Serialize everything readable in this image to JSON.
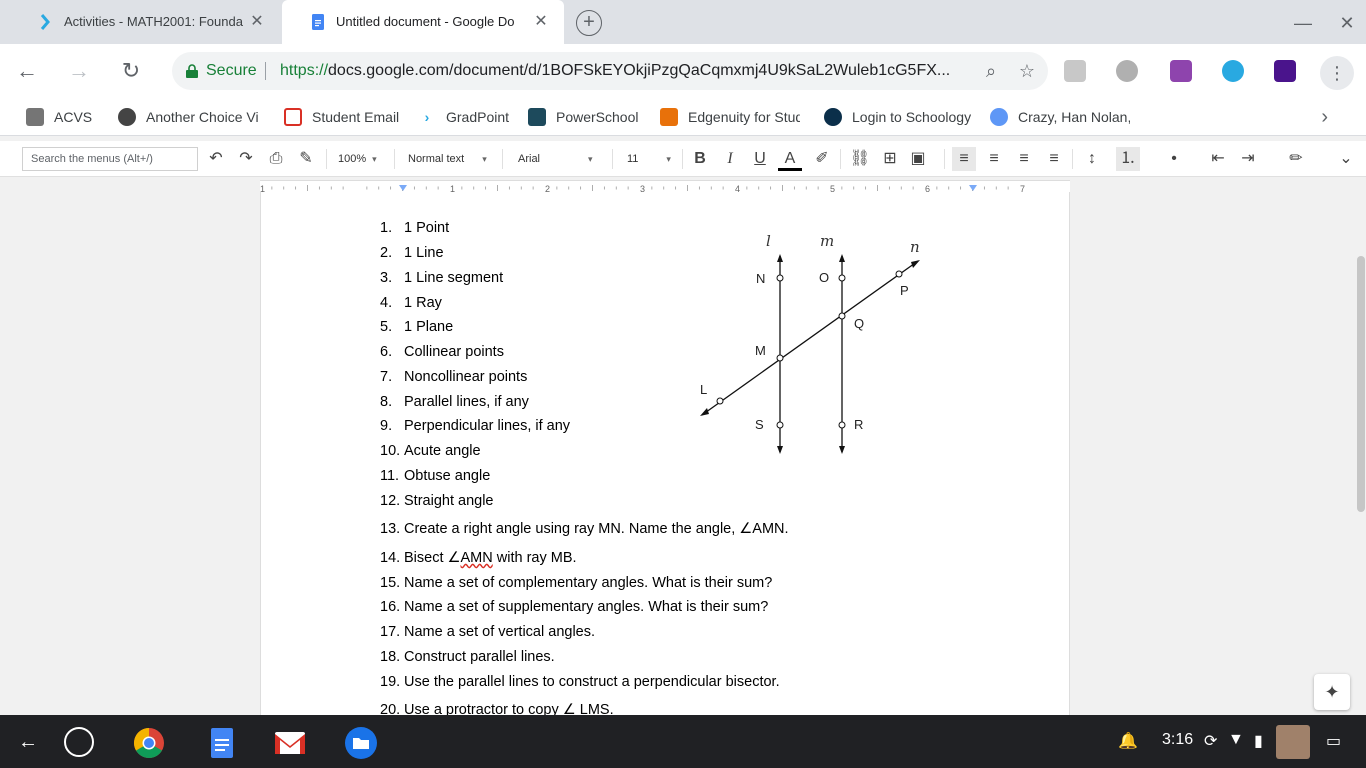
{
  "browser": {
    "tabs": [
      {
        "title": "Activities - MATH2001: Founda",
        "active": false
      },
      {
        "title": "Untitled document - Google Do",
        "active": true
      }
    ],
    "omnibox": {
      "secure_label": "Secure",
      "url_scheme": "https://",
      "url_rest": "docs.google.com/document/d/1BOFSkEYOkjiPzgQaCqmxmj4U9kSaL2Wuleb1cG5FX..."
    },
    "bookmarks": [
      "ACVS",
      "Another Choice Vir",
      "Student Email",
      "GradPoint",
      "PowerSchool",
      "Edgenuity for Stud",
      "Login to Schoology",
      "Crazy, Han Nolan, I"
    ]
  },
  "toolbar": {
    "search_placeholder": "Search the menus (Alt+/)",
    "zoom": "100%",
    "style": "Normal text",
    "font": "Arial",
    "size": "11",
    "bold": "B",
    "italic": "I",
    "underline": "U",
    "text_color": "A"
  },
  "ruler": {
    "marks": [
      "1",
      "1",
      "2",
      "3",
      "4",
      "5",
      "6",
      "7"
    ]
  },
  "document": {
    "items": [
      {
        "num": "1.",
        "text": "1 Point"
      },
      {
        "num": "2.",
        "text": "1 Line"
      },
      {
        "num": "3.",
        "text": "1 Line segment"
      },
      {
        "num": "4.",
        "text": "1 Ray"
      },
      {
        "num": "5.",
        "text": "1 Plane"
      },
      {
        "num": "6.",
        "text": "Collinear points"
      },
      {
        "num": "7.",
        "text": "Noncollinear points"
      },
      {
        "num": "8.",
        "text": "Parallel lines, if any"
      },
      {
        "num": "9.",
        "text": "Perpendicular lines, if any"
      },
      {
        "num": "10.",
        "text": "Acute angle"
      },
      {
        "num": "11.",
        "text": "Obtuse angle"
      },
      {
        "num": "12.",
        "text": "Straight angle"
      },
      {
        "num": "13.",
        "text": "Create a right angle using ray MN.  Name the angle, ∠AMN."
      },
      {
        "num": "14.",
        "text_before": "Bisect ∠",
        "text_wavy": "AMN",
        "text_after": " with ray MB."
      },
      {
        "num": "15.",
        "text": "Name a set of complementary angles.  What is their sum?"
      },
      {
        "num": "16.",
        "text": "Name a set of supplementary angles.  What is their sum?"
      },
      {
        "num": "17.",
        "text": "Name a set of vertical angles."
      },
      {
        "num": "18.",
        "text": "Construct parallel lines."
      },
      {
        "num": "19.",
        "text": "Use the parallel lines to construct a perpendicular bisector."
      },
      {
        "num": "20.",
        "text": "Use a protractor to copy ∠ LMS."
      }
    ],
    "figure_labels": {
      "l": "l",
      "m": "m",
      "n": "n",
      "N": "N",
      "O": "O",
      "P": "P",
      "Q": "Q",
      "M": "M",
      "L": "L",
      "S": "S",
      "R": "R"
    }
  },
  "shelf": {
    "time": "3:16"
  }
}
